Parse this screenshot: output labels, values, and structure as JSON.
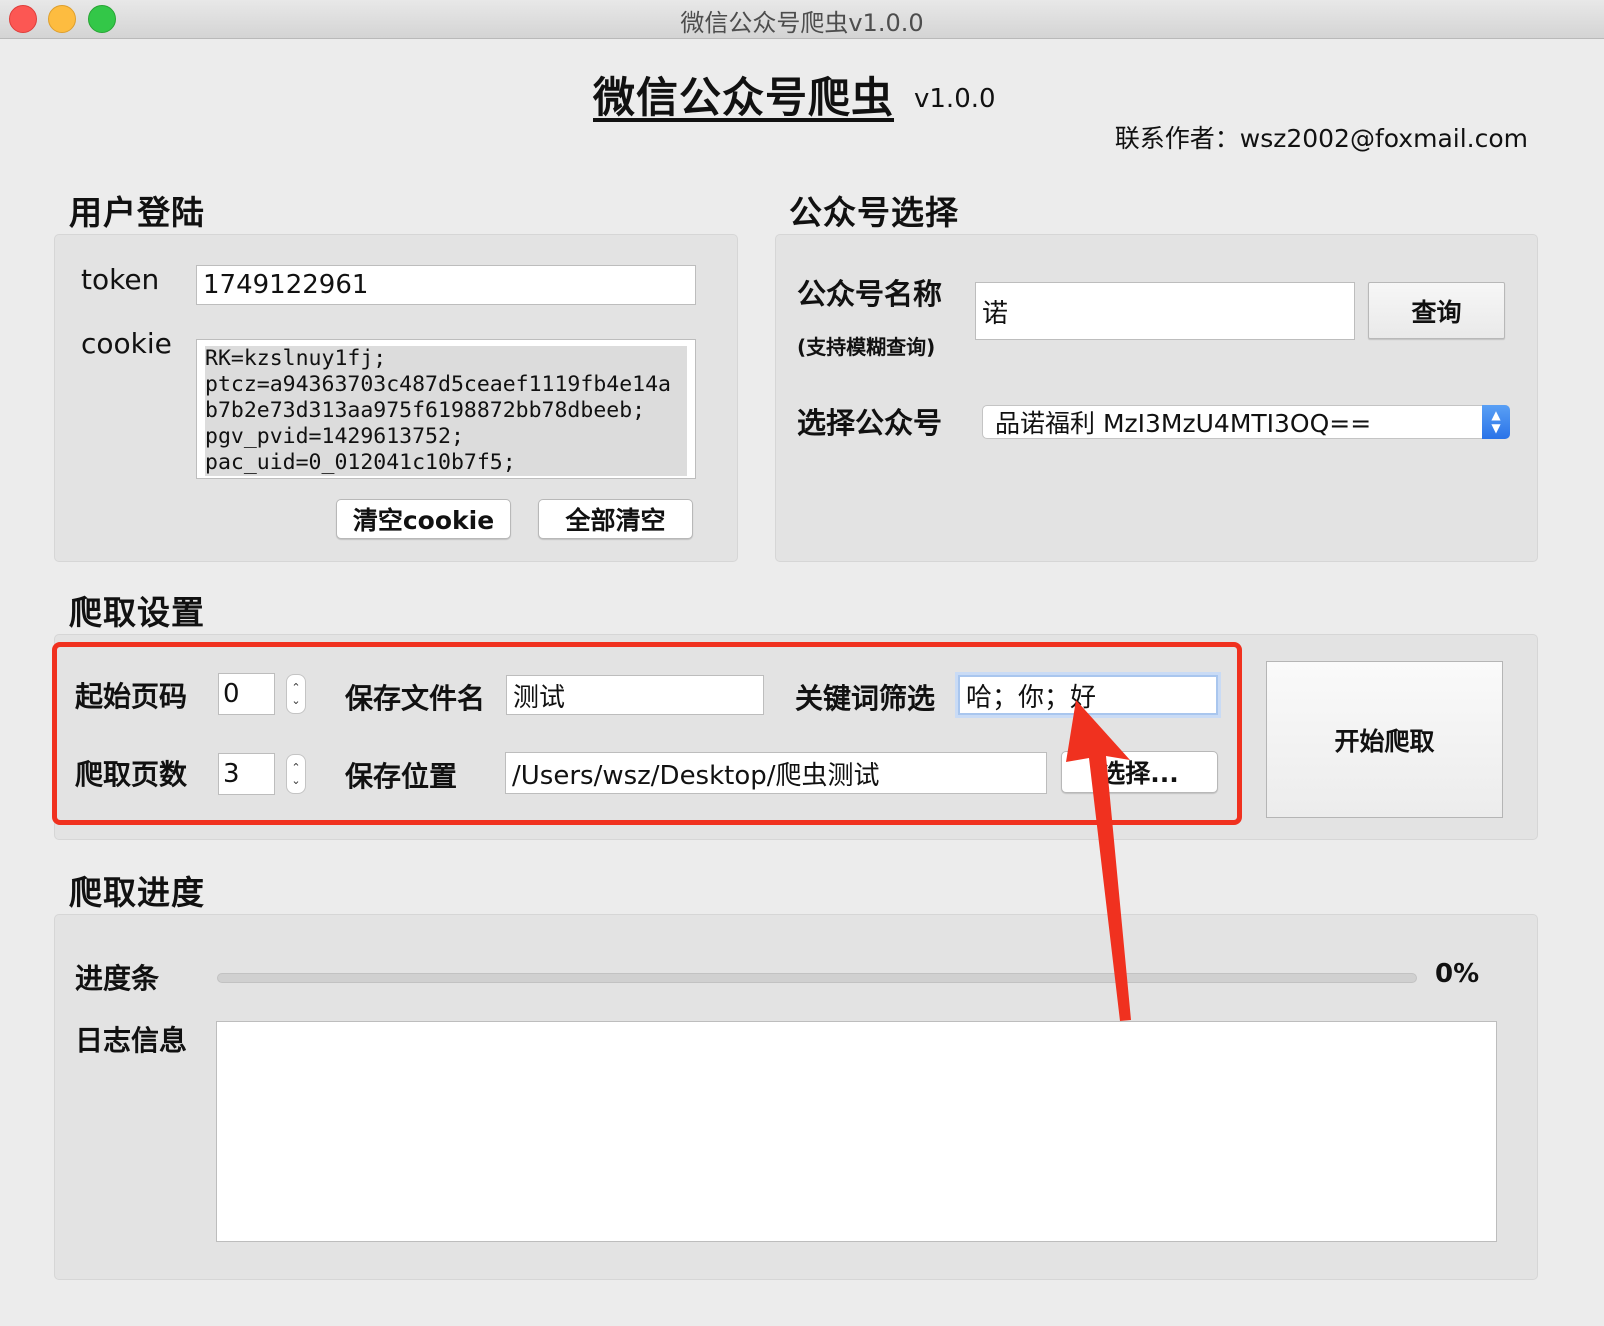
{
  "window": {
    "title": "微信公众号爬虫v1.0.0"
  },
  "header": {
    "title": "微信公众号爬虫",
    "version": "v1.0.0",
    "contact": "联系作者：wsz2002@foxmail.com"
  },
  "login": {
    "section_title": "用户登陆",
    "token_label": "token",
    "token_value": "1749122961",
    "cookie_label": "cookie",
    "cookie_lines": "RK=kzslnuy1fj;\nptcz=a94363703c487d5ceaef1119fb4e14a\nb7b2e73d313aa975f6198872bb78dbeeb;\npgv_pvid=1429613752;\npac_uid=0_012041c10b7f5;",
    "clear_cookie_button": "清空cookie",
    "clear_all_button": "全部清空"
  },
  "account": {
    "section_title": "公众号选择",
    "name_label": "公众号名称",
    "name_hint": "(支持模糊查询)",
    "name_value": "诺",
    "query_button": "查询",
    "select_label": "选择公众号",
    "select_value": "品诺福利   MzI3MzU4MTI3OQ=="
  },
  "crawl": {
    "section_title": "爬取设置",
    "start_page_label": "起始页码",
    "start_page_value": "0",
    "page_count_label": "爬取页数",
    "page_count_value": "3",
    "filename_label": "保存文件名",
    "filename_value": "测试",
    "keyword_label": "关键词筛选",
    "keyword_value": "哈；你；好",
    "location_label": "保存位置",
    "location_value": "/Users/wsz/Desktop/爬虫测试",
    "choose_button": "选择...",
    "start_button": "开始爬取"
  },
  "progress": {
    "section_title": "爬取进度",
    "bar_label": "进度条",
    "percent_text": "0%",
    "percent_value": 0,
    "log_label": "日志信息",
    "log_text": ""
  },
  "colors": {
    "annotation": "#f0311f",
    "accent": "#2a73e8"
  },
  "icons": {
    "stepper": "up-down-stepper-icon",
    "select_arrow": "select-updown-icon"
  }
}
